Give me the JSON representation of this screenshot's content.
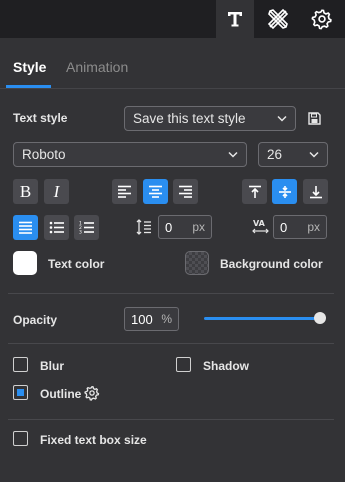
{
  "toolbar": {
    "tools": [
      {
        "name": "text-tool",
        "icon": "text-T-icon",
        "active": true
      },
      {
        "name": "edit-tool",
        "icon": "pencil-ruler-icon",
        "active": false
      },
      {
        "name": "settings-tool",
        "icon": "gear-icon",
        "active": false
      }
    ]
  },
  "tabs": [
    {
      "label": "Style",
      "active": true
    },
    {
      "label": "Animation",
      "active": false
    }
  ],
  "text_style": {
    "label": "Text style",
    "dropdown_value": "Save this text style",
    "save_icon": "floppy-save-icon"
  },
  "font": {
    "family": "Roboto",
    "size": "26"
  },
  "formatting": {
    "bold_glyph": "B",
    "italic_glyph": "I",
    "align_active": "center",
    "valign_active": "middle",
    "list_active": "align-justify"
  },
  "spacing": {
    "line_height": "0",
    "line_height_unit": "px",
    "letter_spacing": "0",
    "letter_spacing_unit": "px"
  },
  "colors": {
    "text_color_label": "Text color",
    "text_color": "#ffffff",
    "background_color_label": "Background color",
    "accent": "#2a8ef0"
  },
  "opacity": {
    "label": "Opacity",
    "value": "100",
    "unit": "%",
    "slider_level": 1.0
  },
  "effects": {
    "blur_label": "Blur",
    "blur_checked": false,
    "shadow_label": "Shadow",
    "shadow_checked": false,
    "outline_label": "Outline",
    "outline_checked": true
  },
  "fixed_box": {
    "label": "Fixed text box size",
    "checked": false
  }
}
